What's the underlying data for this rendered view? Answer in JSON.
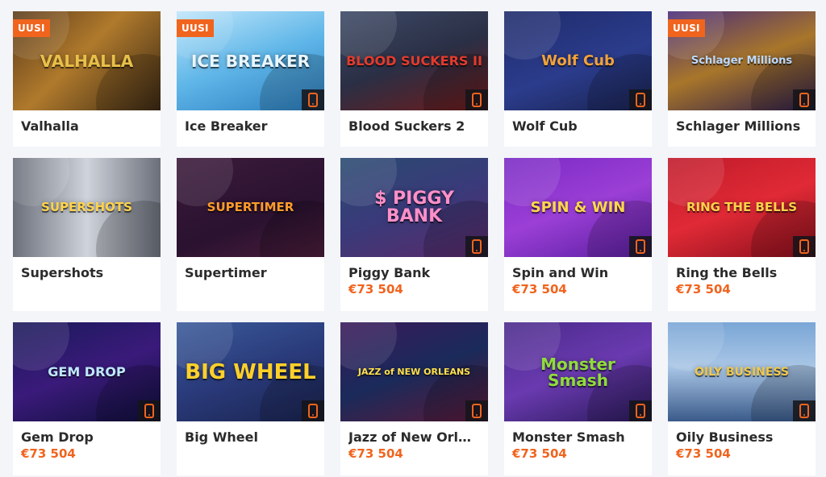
{
  "new_badge_label": "UUSI",
  "games": [
    {
      "name": "Valhalla",
      "logo": "VALHALLA",
      "new": true,
      "mobile": false,
      "jackpot": "",
      "logo_color": "#e8c04a",
      "bg": "linear-gradient(135deg,#5b3a1a 0%,#b07a2c 45%,#3a2814 100%)"
    },
    {
      "name": "Ice Breaker",
      "logo": "ICE BREAKER",
      "new": true,
      "mobile": true,
      "jackpot": "",
      "logo_color": "#e9f6ff",
      "bg": "linear-gradient(160deg,#bfe6fb 0%,#5fb6e8 50%,#2c7fc0 100%)"
    },
    {
      "name": "Blood Suckers 2",
      "logo": "BLOOD SUCKERS II",
      "new": false,
      "mobile": true,
      "jackpot": "",
      "logo_color": "#e23b2c",
      "bg": "linear-gradient(160deg,#3d4a66 0%,#2a2f45 50%,#6e1b1b 100%)"
    },
    {
      "name": "Wolf Cub",
      "logo": "Wolf Cub",
      "new": false,
      "mobile": true,
      "jackpot": "",
      "logo_color": "#f2a23a",
      "bg": "linear-gradient(160deg,#1f2b6a 0%,#2b3c8c 55%,#1a2350 100%)"
    },
    {
      "name": "Schlager Millions",
      "logo": "Schlager Millions",
      "new": true,
      "mobile": true,
      "jackpot": "",
      "logo_color": "#bcd9ff",
      "bg": "linear-gradient(160deg,#4a2d7a 0%,#a8762a 50%,#2d1d4a 100%)"
    },
    {
      "name": "Supershots",
      "logo": "SUPERSHOTS",
      "new": false,
      "mobile": false,
      "jackpot": "",
      "logo_color": "#ffd34a",
      "bg": "linear-gradient(90deg,#6a6f7a 0%,#cfd3da 50%,#6a6f7a 100%)"
    },
    {
      "name": "Supertimer",
      "logo": "SUPERTIMER",
      "new": false,
      "mobile": false,
      "jackpot": "",
      "logo_color": "#ff9c2a",
      "bg": "linear-gradient(160deg,#3b1a3a 0%,#2a1230 60%,#4a1d3a 100%)"
    },
    {
      "name": "Piggy Bank",
      "logo": "$ PIGGY BANK",
      "new": false,
      "mobile": true,
      "jackpot": "€73 504",
      "logo_color": "#ff8fc8",
      "bg": "linear-gradient(160deg,#2a4a70 0%,#3a3a7a 50%,#5a2a6a 100%)"
    },
    {
      "name": "Spin and Win",
      "logo": "SPIN & WIN",
      "new": false,
      "mobile": true,
      "jackpot": "€73 504",
      "logo_color": "#ffd84a",
      "bg": "linear-gradient(160deg,#7a2ac4 0%,#9b3fd6 50%,#5a1ea0 100%)"
    },
    {
      "name": "Ring the Bells",
      "logo": "RING THE BELLS",
      "new": false,
      "mobile": true,
      "jackpot": "€73 504",
      "logo_color": "#ffd24a",
      "bg": "linear-gradient(160deg,#c01a2a 0%,#e02a36 50%,#8a0f1c 100%)"
    },
    {
      "name": "Gem Drop",
      "logo": "GEM DROP",
      "new": false,
      "mobile": true,
      "jackpot": "€73 504",
      "logo_color": "#bfe8ff",
      "bg": "linear-gradient(160deg,#1a1a5a 0%,#3a1a7a 50%,#0f0f3a 100%)"
    },
    {
      "name": "Big Wheel",
      "logo": "BIG WHEEL",
      "new": false,
      "mobile": true,
      "jackpot": "",
      "logo_color": "#ffd02a",
      "bg": "linear-gradient(160deg,#3a5a9a 0%,#2a3a7a 50%,#1a2450 100%)"
    },
    {
      "name": "Jazz of New Orl…",
      "logo": "JAZZ of NEW ORLEANS",
      "new": false,
      "mobile": true,
      "jackpot": "€73 504",
      "logo_color": "#ffe04a",
      "bg": "linear-gradient(160deg,#3a1a5a 0%,#1a2a5a 50%,#5a1a3a 100%)"
    },
    {
      "name": "Monster Smash",
      "logo": "Monster Smash",
      "new": false,
      "mobile": true,
      "jackpot": "€73 504",
      "logo_color": "#8fdc3a",
      "bg": "linear-gradient(160deg,#4a2a8a 0%,#6a3ab0 50%,#2a1a5a 100%)"
    },
    {
      "name": "Oily Business",
      "logo": "OILY BUSINESS",
      "new": false,
      "mobile": true,
      "jackpot": "€73 504",
      "logo_color": "#f0c84a",
      "bg": "linear-gradient(180deg,#7aa6d6 0%,#a9c6e6 45%,#3a5a8a 100%)"
    }
  ]
}
